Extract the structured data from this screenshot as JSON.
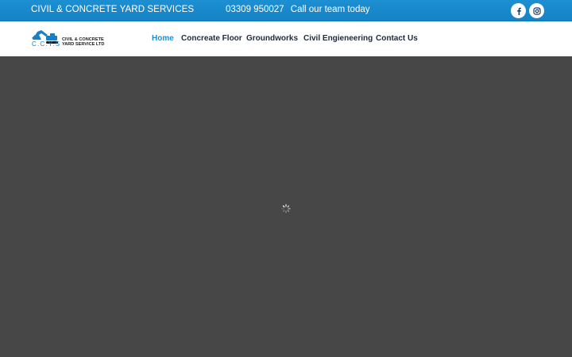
{
  "topbar": {
    "company": "CIVIL & CONCRETE YARD SERVICES",
    "phone": "03309 950027",
    "cta": "Call our team today",
    "bg_color": "#1a8bcf",
    "social": [
      {
        "icon": "facebook-icon",
        "glyph": "f"
      },
      {
        "icon": "instagram-icon"
      }
    ]
  },
  "logo": {
    "abbr": "C.C.Y.S",
    "line1": "CIVIL & CONCRETE",
    "line2": "YARD SERVICE LTD",
    "accent": "#1a7fc4"
  },
  "nav": {
    "items": [
      {
        "label": "Home",
        "active": true
      },
      {
        "label": "Concreate Floor",
        "active": false
      },
      {
        "label": "Groundworks",
        "active": false
      },
      {
        "label": "Civil Engieneering",
        "active": false
      },
      {
        "label": "Contact Us",
        "active": false
      }
    ],
    "active_color": "#1a8fd0",
    "text_color": "#1e2a3a"
  },
  "hero": {
    "bg_color": "#474747",
    "loading_icon": "spinner-icon"
  }
}
